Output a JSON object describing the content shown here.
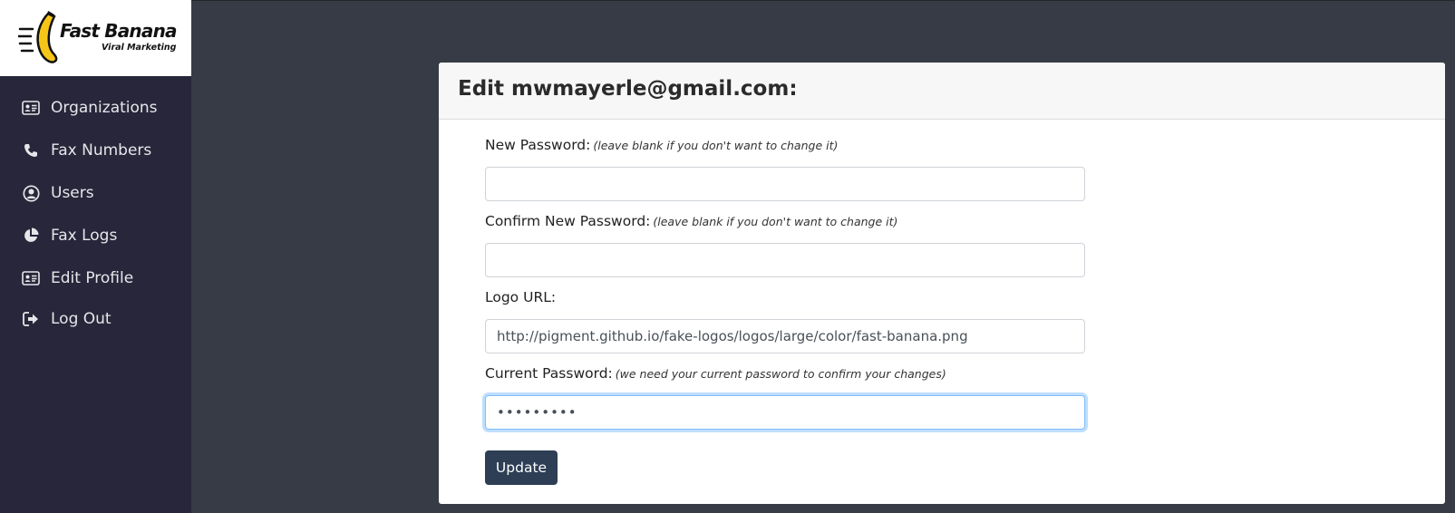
{
  "brand": {
    "name": "Fast Banana",
    "tagline": "Viral Marketing",
    "logo_color": "#f5c518"
  },
  "sidebar": {
    "items": [
      {
        "label": "Organizations",
        "icon": "id-card-icon"
      },
      {
        "label": "Fax Numbers",
        "icon": "phone-icon"
      },
      {
        "label": "Users",
        "icon": "user-circle-icon"
      },
      {
        "label": "Fax Logs",
        "icon": "pie-chart-icon"
      },
      {
        "label": "Edit Profile",
        "icon": "id-card-icon"
      },
      {
        "label": "Log Out",
        "icon": "sign-out-icon"
      }
    ]
  },
  "form": {
    "title": "Edit mwmayerle@gmail.com:",
    "new_password": {
      "label": "New Password:",
      "hint": "(leave blank if you don't want to change it)",
      "value": ""
    },
    "confirm_password": {
      "label": "Confirm New Password:",
      "hint": "(leave blank if you don't want to change it)",
      "value": ""
    },
    "logo_url": {
      "label": "Logo URL:",
      "value": "http://pigment.github.io/fake-logos/logos/large/color/fast-banana.png"
    },
    "current_password": {
      "label": "Current Password:",
      "hint": "(we need your current password to confirm your changes)",
      "value": "•••••••••"
    },
    "submit_label": "Update"
  },
  "colors": {
    "sidebar_bg": "#27263a",
    "page_bg": "#373b45",
    "button_bg": "#2d3e55",
    "focus_ring": "#80bdff"
  }
}
